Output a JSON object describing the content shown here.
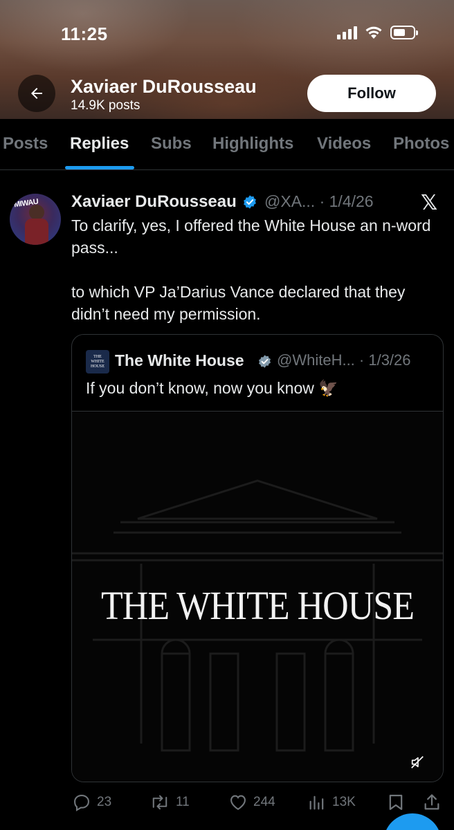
{
  "status_bar": {
    "time": "11:25"
  },
  "profile_header": {
    "name": "Xaviaer DuRousseau",
    "posts": "14.9K posts",
    "follow_label": "Follow"
  },
  "tabs": [
    {
      "label": "Posts",
      "active": false
    },
    {
      "label": "Replies",
      "active": true
    },
    {
      "label": "Subs",
      "active": false
    },
    {
      "label": "Highlights",
      "active": false
    },
    {
      "label": "Videos",
      "active": false
    },
    {
      "label": "Photos",
      "active": false
    }
  ],
  "tweet": {
    "author": "Xaviaer DuRousseau",
    "handle_date": "@XA... · 1/4/26",
    "avatar_sign_text": "MIWAU",
    "paragraph1": "To clarify, yes, I offered the White House an n-word pass...",
    "paragraph2": "to which VP Ja’Darius Vance declared that they didn’t need my permission.",
    "quote": {
      "author": "The White House",
      "handle_date": "@WhiteH... · 1/3/26",
      "logo_text": [
        "THE",
        "WHITE",
        "HOUSE"
      ],
      "text": "If you don’t know, now you know",
      "emoji": "🦅",
      "media_title": "THE WHITE HOUSE"
    },
    "stats": {
      "replies": "23",
      "reposts": "11",
      "likes": "244",
      "views": "13K"
    }
  },
  "colors": {
    "accent": "#1d9bf0",
    "background": "#000000",
    "text_primary": "#e7e9ea",
    "text_secondary": "#71767b",
    "border": "#2f3336"
  },
  "icons": [
    "back-arrow-icon",
    "signal-icon",
    "wifi-icon",
    "battery-icon",
    "verified-badge-icon",
    "x-logo-icon",
    "mute-icon",
    "reply-icon",
    "repost-icon",
    "like-icon",
    "views-icon",
    "bookmark-icon",
    "share-icon"
  ]
}
